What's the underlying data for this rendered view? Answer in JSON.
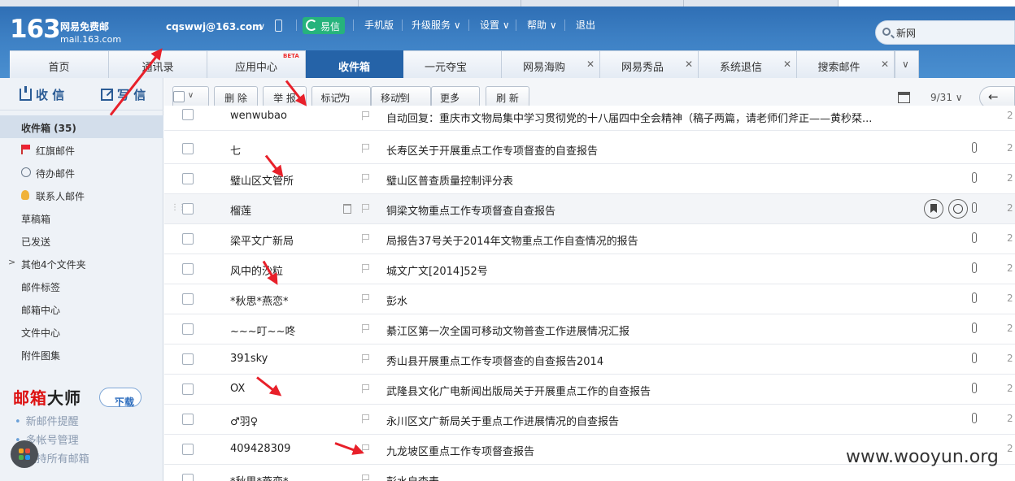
{
  "header": {
    "logo_num": "163",
    "logo_cn": "网易免费邮",
    "logo_domain": "mail.163.com",
    "user_email": "cqswwj@163.com",
    "yixin_label": "易信",
    "nav": [
      "手机版",
      "升级服务",
      "设置",
      "帮助",
      "退出"
    ],
    "search_value": "新网"
  },
  "tabs": {
    "items": [
      "首页",
      "通讯录",
      "应用中心",
      "收件箱",
      "一元夺宝",
      "网易海购",
      "网易秀品",
      "系统退信",
      "搜索邮件"
    ],
    "beta": "BETA",
    "more": "∨"
  },
  "sidebar": {
    "receive": "收 信",
    "write": "写 信",
    "folders": [
      "收件箱 (35)",
      "红旗邮件",
      "待办邮件",
      "联系人邮件",
      "草稿箱",
      "已发送",
      "其他4个文件夹",
      "邮件标签",
      "邮箱中心",
      "文件中心",
      "附件图集"
    ],
    "promo_title_a": "邮箱",
    "promo_title_b": "大师",
    "promo_download": "下载",
    "promo_items": [
      "新邮件提醒",
      "多帐号管理",
      "支持所有邮箱"
    ]
  },
  "toolbar": {
    "delete": "删 除",
    "report": "举 报",
    "mark_as": "标记为",
    "move_to": "移动到",
    "more": "更多",
    "refresh": "刷 新",
    "page": "9/31"
  },
  "emails": [
    {
      "sender": "wenwubao",
      "subject": "自动回复：重庆市文物局集中学习贯彻党的十八届四中全会精神（稿子两篇，请老师们斧正——黄秒栞..."
    },
    {
      "sender": "七",
      "subject": "长寿区关于开展重点工作专项督查的自查报告"
    },
    {
      "sender": "璧山区文管所",
      "subject": "璧山区普查质量控制评分表"
    },
    {
      "sender": "榴莲",
      "subject": "铜梁文物重点工作专项督查自查报告"
    },
    {
      "sender": "梁平文广新局",
      "subject": "局报告37号关于2014年文物重点工作自查情况的报告"
    },
    {
      "sender": "风中的沙粒",
      "subject": "城文广文[2014]52号"
    },
    {
      "sender": "*秋思*燕恋*",
      "subject": "彭水"
    },
    {
      "sender": "~~~叮~~咚",
      "subject": "綦江区第一次全国可移动文物普查工作进展情况汇报"
    },
    {
      "sender": "391sky",
      "subject": "秀山县开展重点工作专项督查的自查报告2014"
    },
    {
      "sender": "OX",
      "subject": "武隆县文化广电新闻出版局关于开展重点工作的自查报告"
    },
    {
      "sender": "♂羽♀",
      "subject": "永川区文广新局关于重点工作进展情况的自查报告"
    },
    {
      "sender": "409428309",
      "subject": "九龙坡区重点工作专项督查报告"
    },
    {
      "sender": "*秋思*燕恋*",
      "subject": "彭水自查表"
    }
  ],
  "date_fragment": "2",
  "watermark": "www.wooyun.org"
}
